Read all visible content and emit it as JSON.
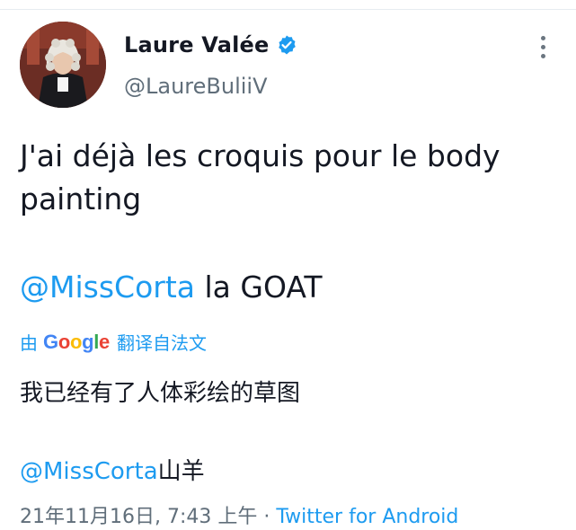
{
  "author": {
    "display_name": "Laure Valée",
    "handle": "@LaureBuliiV",
    "verified": true,
    "avatar_icon": "avatar-photo-judge-wig"
  },
  "tweet": {
    "text": "J'ai déjà les croquis pour le body painting",
    "mention": "@MissCorta",
    "mention_suffix": " la GOAT"
  },
  "translation": {
    "prefix": "由",
    "provider": [
      "G",
      "o",
      "o",
      "g",
      "l",
      "e"
    ],
    "suffix": "翻译自法文",
    "text": "我已经有了人体彩绘的草图",
    "mention": "@MissCorta",
    "mention_suffix": "山羊"
  },
  "meta": {
    "timestamp": "21年11月16日, 7:43 上午",
    "separator": " · ",
    "source": "Twitter for Android"
  },
  "colors": {
    "link": "#1d9bf0",
    "verified": "#1d9bf0",
    "secondary_text": "#606e7a"
  },
  "icons": {
    "verified": "verified-badge-icon",
    "more": "more-vertical-icon"
  }
}
